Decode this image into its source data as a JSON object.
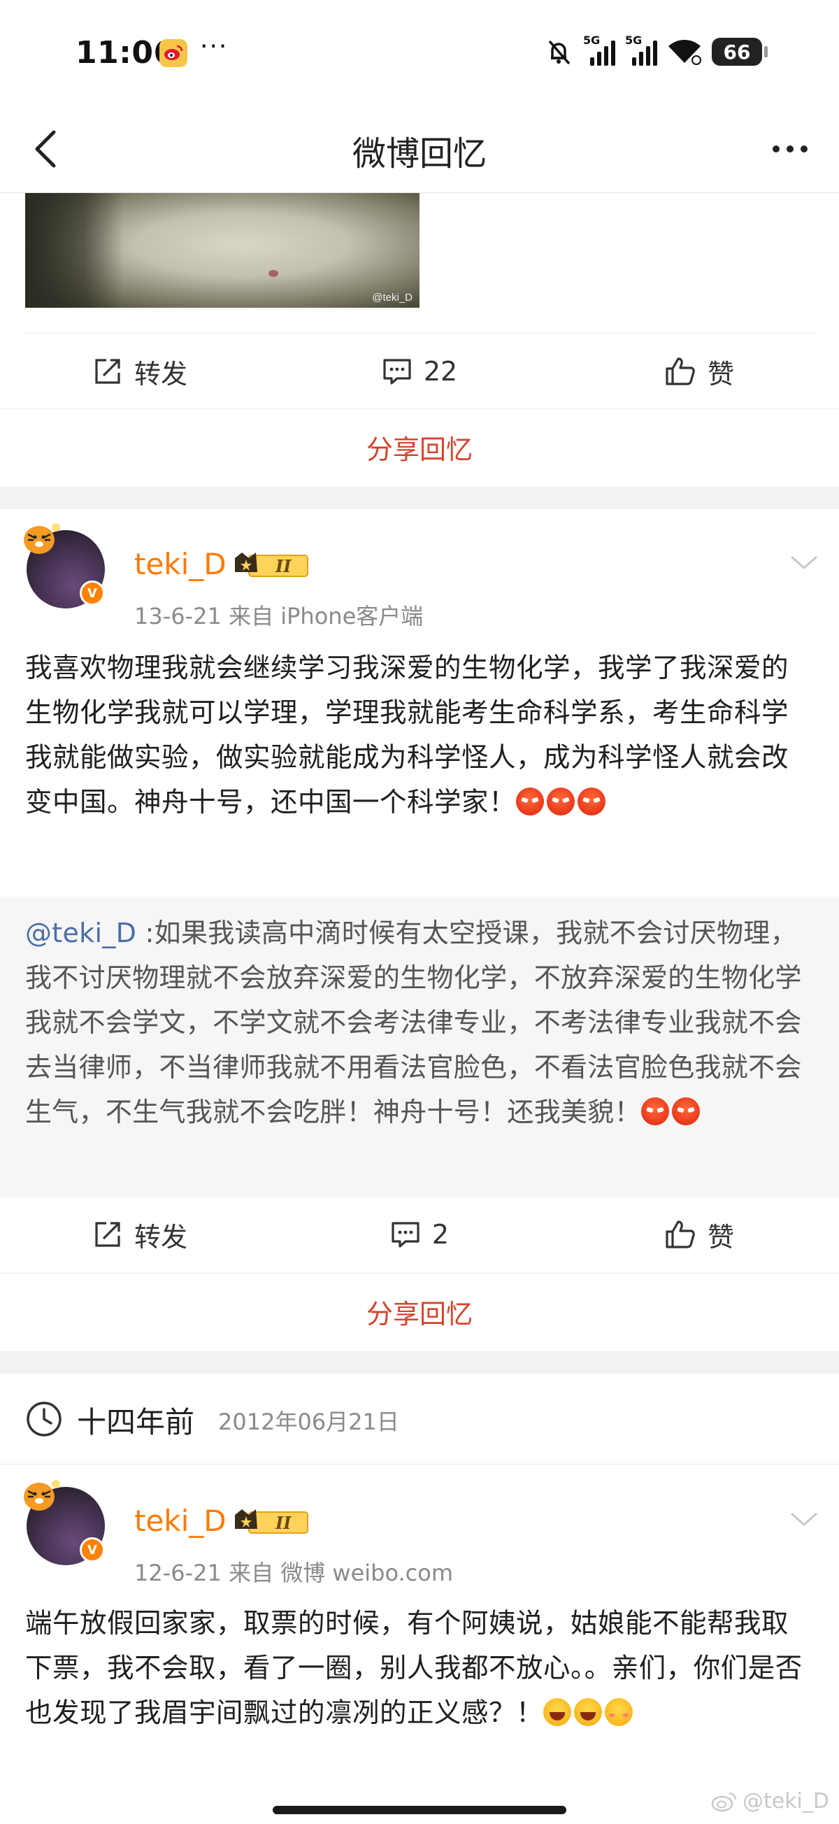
{
  "status_bar": {
    "time": "11:06",
    "dots": "···",
    "signal_1": "5G",
    "signal_2": "5G",
    "battery": "66"
  },
  "nav": {
    "title": "微博回忆"
  },
  "image": {
    "watermark": "@teki_D"
  },
  "action_bar_1": {
    "repost": "转发",
    "comments": "22",
    "like": "赞"
  },
  "share_1": "分享回忆",
  "post_1": {
    "username": "teki_D",
    "rank": "II",
    "meta": "13-6-21   来自 iPhone客户端",
    "text": "我喜欢物理我就会继续学习我深爱的生物化学，我学了我深爱的生物化学我就可以学理，学理我就能考生命科学系，考生命科学我就能做实验，做实验就能成为科学怪人，成为科学怪人就会改变中国。神舟十号，还中国一个科学家！",
    "repost_mention": "@teki_D",
    "repost_text": " :如果我读高中滴时候有太空授课，我就不会讨厌物理，我不讨厌物理就不会放弃深爱的生物化学，不放弃深爱的生物化学我就不会学文，不学文就不会考法律专业，不考法律专业我就不会去当律师，不当律师我就不用看法官脸色，不看法官脸色我就不会生气，不生气我就不会吃胖！神舟十号！还我美貌！"
  },
  "action_bar_2": {
    "repost": "转发",
    "comments": "2",
    "like": "赞"
  },
  "share_2": "分享回忆",
  "time_header": {
    "ago": "十四年前",
    "date": "2012年06月21日"
  },
  "post_2": {
    "username": "teki_D",
    "rank": "II",
    "meta": "12-6-21   来自 微博 weibo.com",
    "text": "端午放假回家家，取票的时候，有个阿姨说，姑娘能不能帮我取下票，我不会取，看了一圈，别人我都不放心。。亲们，你们是否也发现了我眉宇间飘过的凛冽的正义感？！"
  },
  "page_watermark": "@teki_D",
  "colors": {
    "accent_share": "#d4442c",
    "username": "#ff7a00",
    "mention": "#4a6ea8"
  }
}
